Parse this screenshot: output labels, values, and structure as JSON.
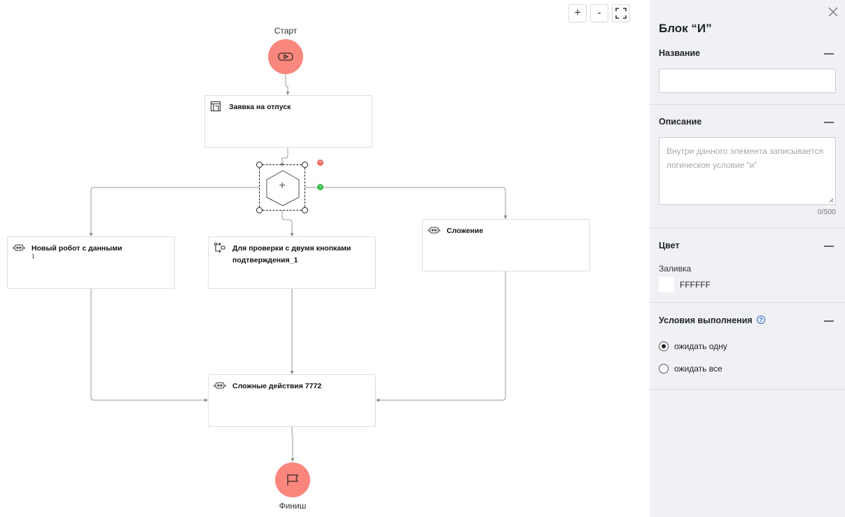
{
  "canvas": {
    "zoom_in_label": "+",
    "zoom_out_label": "-",
    "fullscreen_icon": "fullscreen-icon",
    "start": {
      "label": "Старт",
      "icon": "play-icon"
    },
    "finish": {
      "label": "Финиш",
      "icon": "flag-icon"
    },
    "nodes": [
      {
        "title": "Заявка на отпуск",
        "subtitle": "",
        "icon": "form-icon"
      },
      {
        "title": "Новый робот с данными",
        "subtitle": "1",
        "icon": "robot-icon"
      },
      {
        "title": "Для проверки с двумя кнопками подтверждения_1",
        "subtitle": "",
        "icon": "flow-icon"
      },
      {
        "title": "Сложение",
        "subtitle": "",
        "icon": "robot-icon"
      },
      {
        "title": "Сложные действия 7772",
        "subtitle": "",
        "icon": "robot-icon"
      }
    ],
    "gateway": {
      "symbol": "+",
      "delete_icon": "close-icon",
      "connect_icon": "arrow-right-icon"
    }
  },
  "panel": {
    "title": "Блок “И”",
    "name_section": {
      "label": "Название",
      "value": ""
    },
    "description_section": {
      "label": "Описание",
      "placeholder": "Внутри данного элемента записывается логическое условие “и”",
      "counter": "0/500"
    },
    "color_section": {
      "label": "Цвет",
      "fill_label": "Заливка",
      "fill_value": "FFFFFF",
      "fill_color": "#FFFFFF"
    },
    "conditions_section": {
      "label": "Условия выполнения",
      "help": "?",
      "options": [
        {
          "label": "ожидать одну",
          "selected": true
        },
        {
          "label": "ожидать все",
          "selected": false
        }
      ]
    }
  },
  "colors": {
    "terminal": "#F9877D",
    "panel_bg": "#F0F1F5",
    "help_blue": "#2A63C9",
    "connect_green": "#3CBF4A",
    "delete_red": "#EE6B5F"
  }
}
